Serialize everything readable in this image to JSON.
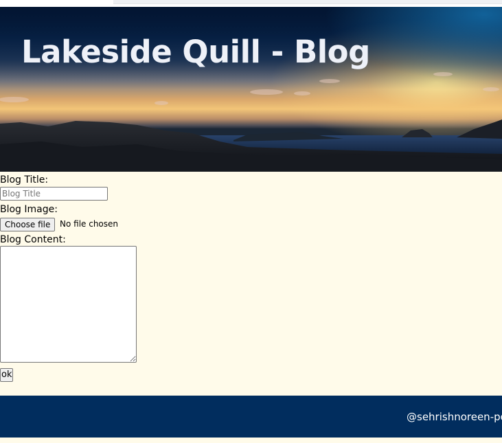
{
  "header": {
    "title": "Lakeside Quill - Blog"
  },
  "form": {
    "title_label": "Blog Title:",
    "title_placeholder": "Blog Title",
    "title_value": "",
    "image_label": "Blog Image:",
    "choose_file_label": "Choose file",
    "file_status": "No file chosen",
    "content_label": "Blog Content:",
    "content_value": "",
    "submit_label": "ok"
  },
  "footer": {
    "credit": "@sehrishnoreen-po"
  },
  "colors": {
    "page_background": "#fffbea",
    "footer_background": "#012d5e",
    "header_text": "#eef1f8"
  }
}
